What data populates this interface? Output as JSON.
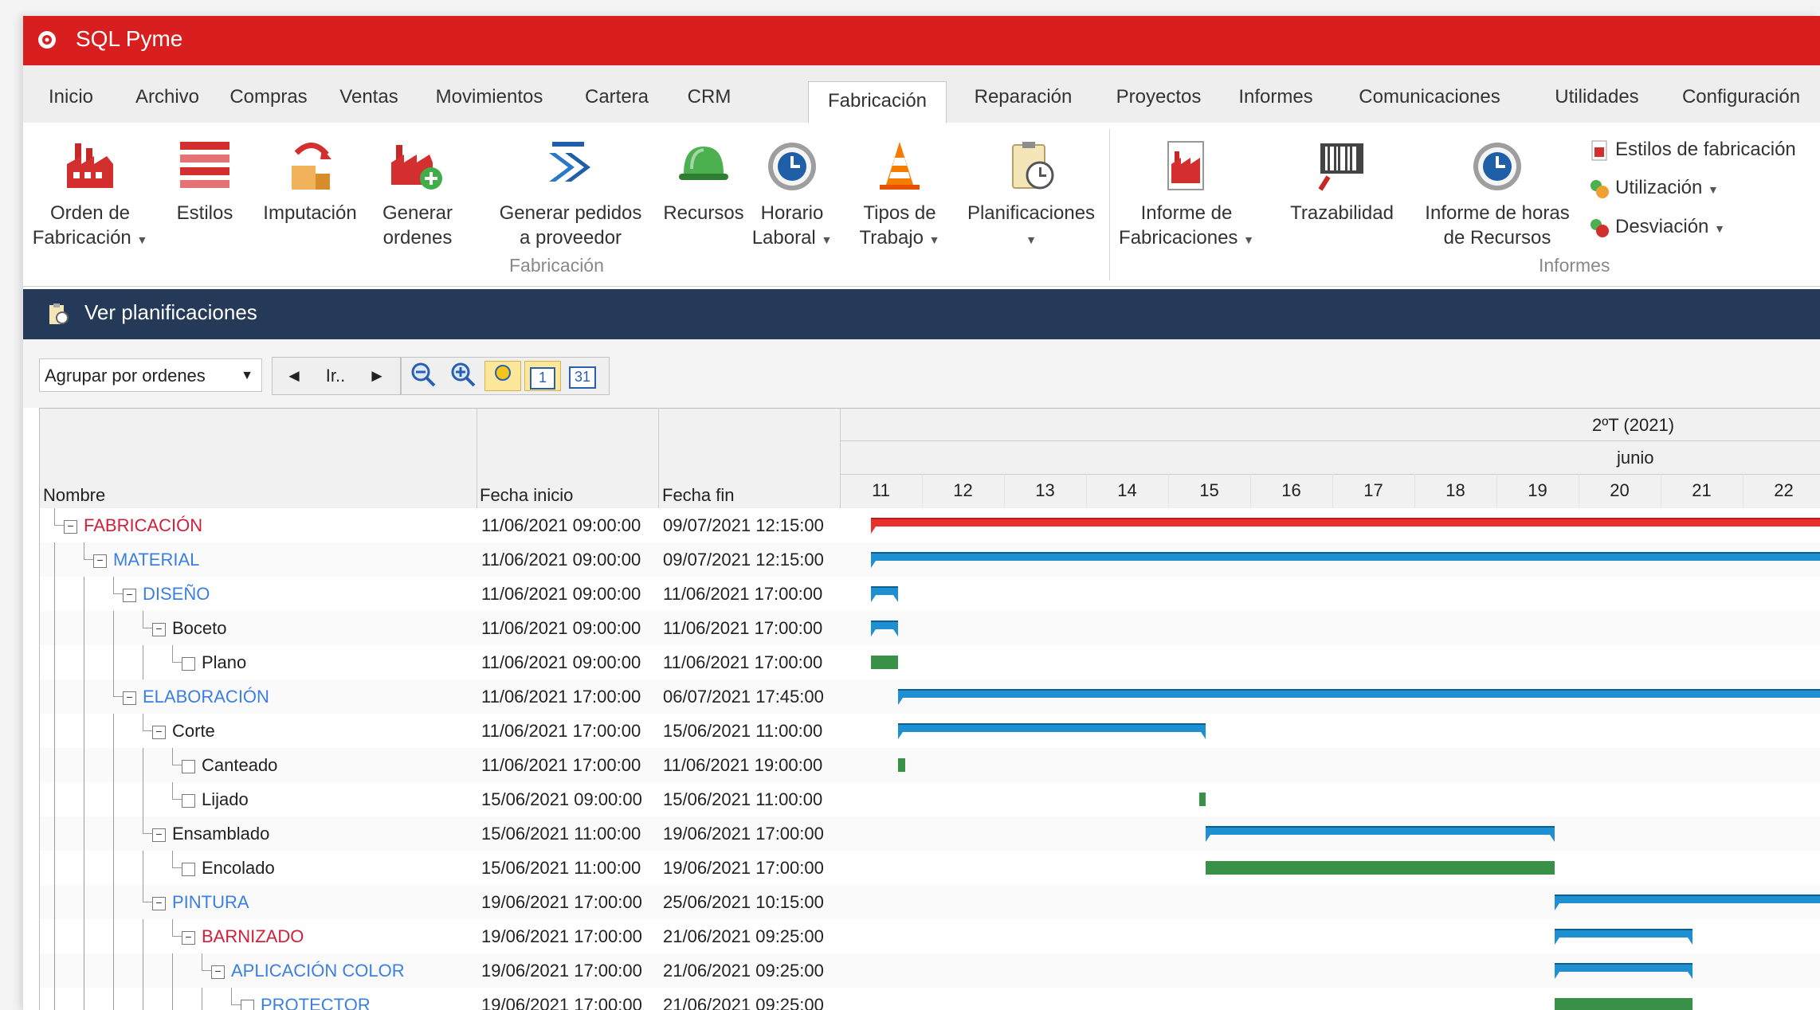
{
  "app": {
    "title": "SQL Pyme"
  },
  "menu": {
    "tabs": [
      "Inicio",
      "Archivo",
      "Compras",
      "Ventas",
      "Movimientos",
      "Cartera",
      "CRM",
      "Fabricación",
      "Reparación",
      "Proyectos",
      "Informes",
      "Comunicaciones",
      "Utilidades",
      "Configuración"
    ],
    "active": "Fabricación"
  },
  "ribbon": {
    "fabricacion": {
      "group_label": "Fabricación",
      "orden_l1": "Orden de",
      "orden_l2": "Fabricación",
      "estilos": "Estilos",
      "imputacion": "Imputación",
      "generar_l1": "Generar",
      "generar_l2": "ordenes",
      "pedidos_l1": "Generar pedidos",
      "pedidos_l2": "a proveedor",
      "recursos": "Recursos",
      "horario_l1": "Horario",
      "horario_l2": "Laboral",
      "tipos_l1": "Tipos de",
      "tipos_l2": "Trabajo",
      "planificaciones": "Planificaciones"
    },
    "informes": {
      "group_label": "Informes",
      "informe_l1": "Informe de",
      "informe_l2": "Fabricaciones",
      "trazabilidad": "Trazabilidad",
      "horas_l1": "Informe de horas",
      "horas_l2": "de Recursos",
      "estilos_fab": "Estilos de fabricación",
      "utilizacion": "Utilización",
      "desviacion": "Desviación"
    }
  },
  "view": {
    "title": "Ver planificaciones"
  },
  "toolbar": {
    "group_select": "Agrupar por ordenes",
    "goto_label": "Ir..",
    "day_icon": "1",
    "month_icon": "31"
  },
  "grid": {
    "col_name": "Nombre",
    "col_start": "Fecha inicio",
    "col_end": "Fecha fin",
    "quarter": "2ºT (2021)",
    "month": "junio",
    "days": [
      "11",
      "12",
      "13",
      "14",
      "15",
      "16",
      "17",
      "18",
      "19",
      "20",
      "21",
      "22"
    ],
    "rows": [
      {
        "name": "FABRICACIÓN",
        "start": "11/06/2021 09:00:00",
        "end": "09/07/2021 12:15:00",
        "level": 0,
        "color": "#d11f3a",
        "toggle": "⊟"
      },
      {
        "name": "MATERIAL",
        "start": "11/06/2021 09:00:00",
        "end": "09/07/2021 12:15:00",
        "level": 1,
        "color": "#3b7fe0",
        "toggle": "⊟"
      },
      {
        "name": "DISEÑO",
        "start": "11/06/2021 09:00:00",
        "end": "11/06/2021 17:00:00",
        "level": 2,
        "color": "#3b7fe0",
        "toggle": "⊟"
      },
      {
        "name": "Boceto",
        "start": "11/06/2021 09:00:00",
        "end": "11/06/2021 17:00:00",
        "level": 3,
        "color": "#222222",
        "toggle": "⊟"
      },
      {
        "name": "Plano",
        "start": "11/06/2021 09:00:00",
        "end": "11/06/2021 17:00:00",
        "level": 4,
        "color": "#222222",
        "toggle": "☐"
      },
      {
        "name": "ELABORACIÓN",
        "start": "11/06/2021 17:00:00",
        "end": "06/07/2021 17:45:00",
        "level": 2,
        "color": "#3b7fe0",
        "toggle": "⊟"
      },
      {
        "name": "Corte",
        "start": "11/06/2021 17:00:00",
        "end": "15/06/2021 11:00:00",
        "level": 3,
        "color": "#222222",
        "toggle": "⊟"
      },
      {
        "name": "Canteado",
        "start": "11/06/2021 17:00:00",
        "end": "11/06/2021 19:00:00",
        "level": 4,
        "color": "#222222",
        "toggle": "☐"
      },
      {
        "name": "Lijado",
        "start": "15/06/2021 09:00:00",
        "end": "15/06/2021 11:00:00",
        "level": 4,
        "color": "#222222",
        "toggle": "☐"
      },
      {
        "name": "Ensamblado",
        "start": "15/06/2021 11:00:00",
        "end": "19/06/2021 17:00:00",
        "level": 3,
        "color": "#222222",
        "toggle": "⊟"
      },
      {
        "name": "Encolado",
        "start": "15/06/2021 11:00:00",
        "end": "19/06/2021 17:00:00",
        "level": 4,
        "color": "#222222",
        "toggle": "☐"
      },
      {
        "name": "PINTURA",
        "start": "19/06/2021 17:00:00",
        "end": "25/06/2021 10:15:00",
        "level": 3,
        "color": "#3b7fe0",
        "toggle": "⊟"
      },
      {
        "name": "BARNIZADO",
        "start": "19/06/2021 17:00:00",
        "end": "21/06/2021 09:25:00",
        "level": 4,
        "color": "#d11f3a",
        "toggle": "⊟"
      },
      {
        "name": "APLICACIÓN COLOR",
        "start": "19/06/2021 17:00:00",
        "end": "21/06/2021 09:25:00",
        "level": 5,
        "color": "#3b7fe0",
        "toggle": "⊟"
      },
      {
        "name": "PROTECTOR",
        "start": "19/06/2021 17:00:00",
        "end": "21/06/2021 09:25:00",
        "level": 6,
        "color": "#3b7fe0",
        "toggle": "☐"
      }
    ]
  },
  "colors": {
    "titlebar": "#d81e1e",
    "viewbar": "#253a59",
    "summary_red": "#e8312b",
    "summary_blue": "#1e8fd0",
    "task_green": "#2e8b3d"
  }
}
